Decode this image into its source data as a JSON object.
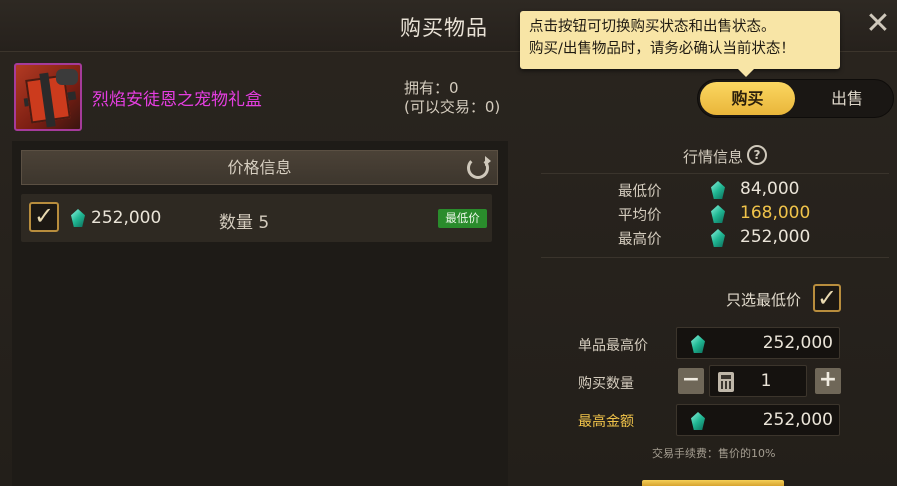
{
  "window": {
    "title": "购买物品",
    "close_label": "✕"
  },
  "tooltip": {
    "line1": "点击按钮可切换购买状态和出售状态。",
    "line2": "购买/出售物品时，请务必确认当前状态！"
  },
  "item": {
    "name": "烈焰安徒恩之宠物礼盒",
    "owned_label": "拥有：0",
    "tradable_label": "(可以交易：0)",
    "rarity_color": "#e43ee0"
  },
  "mode_toggle": {
    "buy_label": "购买",
    "sell_label": "出售",
    "active": "buy",
    "active_color": "#fbd761"
  },
  "price_panel": {
    "title": "价格信息",
    "listings": [
      {
        "price": "252,000",
        "qty_label": "数量 5",
        "badge": "最低价",
        "checked": "✓"
      }
    ]
  },
  "market": {
    "title": "行情信息",
    "help": "?",
    "rows": [
      {
        "label": "最低价",
        "value": "84,000"
      },
      {
        "label": "平均价",
        "value": "168,000"
      },
      {
        "label": "最高价",
        "value": "252,000"
      }
    ]
  },
  "purchase_form": {
    "lowest_only_label": "只选最低价",
    "lowest_only_checked": "✓",
    "max_unit_price_label": "单品最高价",
    "max_unit_price": "252,000",
    "quantity_label": "购买数量",
    "quantity": "1",
    "minus_label": "−",
    "plus_label": "+",
    "max_total_label": "最高金额",
    "max_total": "252,000",
    "fee_note": "交易手续费：售价的10%"
  },
  "colors": {
    "accent": "#f0c34a",
    "currency_gem": "#21b894",
    "badge_green": "#2a8c2c"
  }
}
